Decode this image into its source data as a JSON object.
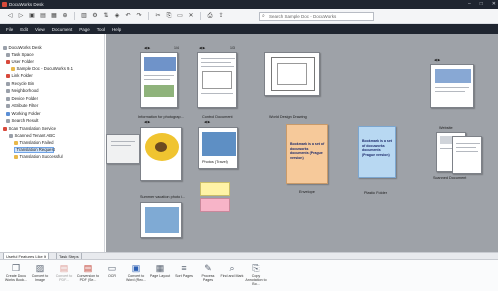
{
  "window": {
    "title": "DocuWorks Desk"
  },
  "toolbar": {
    "search_placeholder": "Search Sample Doc - DocuWorks"
  },
  "menu": [
    "File",
    "Edit",
    "View",
    "Document",
    "Page",
    "Tool",
    "Help"
  ],
  "sidebar": {
    "items": [
      {
        "label": "DocuWorks Desk"
      },
      {
        "label": "Task Space"
      },
      {
        "label": "User Folder"
      },
      {
        "label": "Sample Doc - DocuWorks 9.1"
      },
      {
        "label": "Link Folder"
      },
      {
        "label": "Recycle Bin"
      },
      {
        "label": "Neighborhood"
      },
      {
        "label": "Device Folder"
      },
      {
        "label": "Attribute Filter"
      },
      {
        "label": "Working Folder"
      },
      {
        "label": "Search Result"
      },
      {
        "label": "Scan Translation Service"
      },
      {
        "label": "Scanned Tenant ABC"
      },
      {
        "label": "Translation Failed"
      },
      {
        "label": "Translation Request"
      },
      {
        "label": "Translation Successful"
      }
    ]
  },
  "canvas": {
    "background": "#9ea2a8",
    "documents": [
      {
        "caption": "Information for photograp...",
        "page_indicator": "1/4"
      },
      {
        "caption": "Control Document",
        "page_indicator": "1/3"
      },
      {
        "caption": "World Design Drawing"
      },
      {
        "caption": "Photos (Travel)"
      },
      {
        "caption": "Envelope",
        "note_text": "Bookmark is a set of docuworks documents (Prague version)"
      },
      {
        "caption": "Plastic Folder",
        "note_text": "Bookmark is a set of docuworks documents (Prague version)"
      },
      {
        "caption": "Website"
      },
      {
        "caption": "Scanned Document"
      },
      {
        "caption": "Summer vacation photo i..."
      }
    ]
  },
  "bottom_tabs": [
    "Useful Features Like It",
    "Task Steps"
  ],
  "ribbon": {
    "buttons": [
      {
        "label": "Create Docu Works Book...",
        "icon": "create-book-icon"
      },
      {
        "label": "Convert to Image",
        "icon": "convert-image-icon"
      },
      {
        "label": "Convert to PDF...",
        "icon": "pdf-icon"
      },
      {
        "label": "Conversion to PDF (Se...",
        "icon": "pdf-secure-icon"
      },
      {
        "label": "OCR",
        "icon": "ocr-icon"
      },
      {
        "label": "Convert to Word (Rec...",
        "icon": "word-icon"
      },
      {
        "label": "Page Layout",
        "icon": "page-layout-icon"
      },
      {
        "label": "Sort Pages",
        "icon": "sort-pages-icon"
      },
      {
        "label": "Process Pages",
        "icon": "process-pages-icon"
      },
      {
        "label": "Find and Mark",
        "icon": "find-mark-icon"
      },
      {
        "label": "Copy Annotation to Bo...",
        "icon": "copy-annotation-icon"
      }
    ]
  }
}
